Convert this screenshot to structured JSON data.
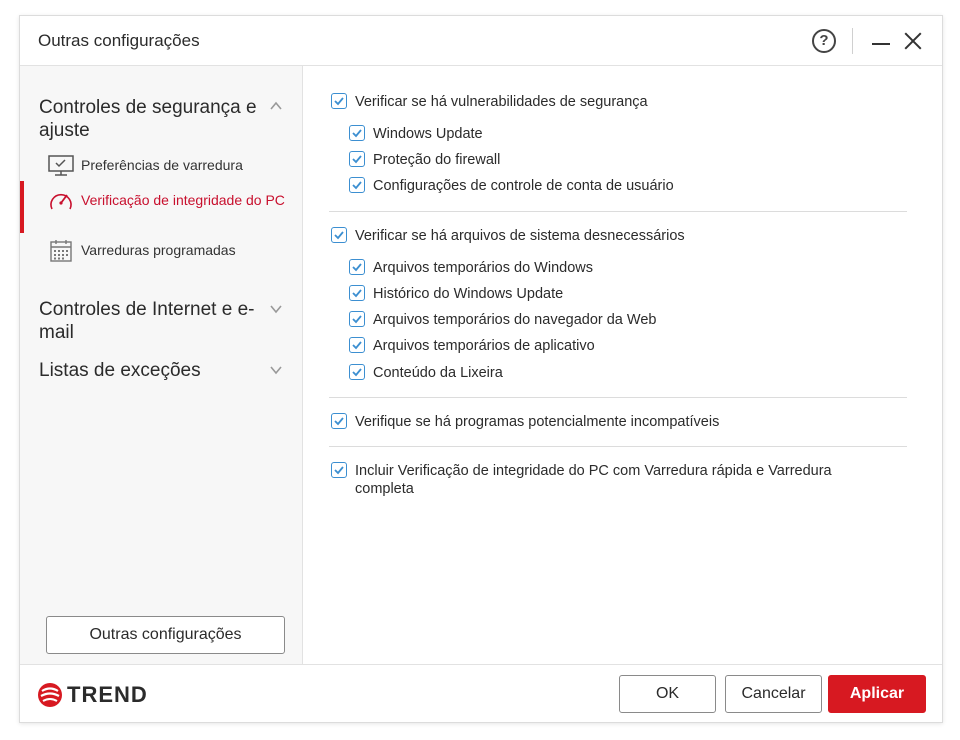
{
  "window": {
    "title": "Outras configurações"
  },
  "titlebar": {
    "help_glyph": "?",
    "help_icon": "help-circle-icon",
    "minimize_icon": "minimize-icon",
    "close_icon": "close-icon"
  },
  "sidebar": {
    "sections": [
      {
        "label": "Controles de segurança e ajuste",
        "expanded": true
      },
      {
        "label": "Controles de Internet e e-mail",
        "expanded": false
      },
      {
        "label": "Listas de exceções",
        "expanded": false
      }
    ],
    "items": [
      {
        "label": "Preferências de varredura",
        "icon": "monitor-check-icon",
        "active": false
      },
      {
        "label": "Verificação de integridade do PC",
        "icon": "gauge-icon",
        "active": true
      },
      {
        "label": "Varreduras programadas",
        "icon": "calendar-icon",
        "active": false
      }
    ],
    "bottom_button": "Outras configurações"
  },
  "content": {
    "groups": [
      {
        "label": "Verificar se há vulnerabilidades de segurança",
        "checked": true,
        "children": [
          {
            "label": "Windows Update",
            "checked": true
          },
          {
            "label": "Proteção do firewall",
            "checked": true
          },
          {
            "label": "Configurações de controle de conta de usuário",
            "checked": true
          }
        ]
      },
      {
        "label": "Verificar se há arquivos de sistema desnecessários",
        "checked": true,
        "children": [
          {
            "label": "Arquivos temporários do Windows",
            "checked": true
          },
          {
            "label": "Histórico do Windows Update",
            "checked": true
          },
          {
            "label": "Arquivos temporários do navegador da Web",
            "checked": true
          },
          {
            "label": "Arquivos temporários de aplicativo",
            "checked": true
          },
          {
            "label": "Conteúdo da Lixeira",
            "checked": true
          }
        ]
      },
      {
        "label": "Verifique se há programas potencialmente incompatíveis",
        "checked": true,
        "children": []
      },
      {
        "label": "Incluir Verificação de integridade do PC com Varredura rápida e Varredura completa",
        "checked": true,
        "children": []
      }
    ]
  },
  "footer": {
    "brand": "TREND",
    "ok_label": "OK",
    "cancel_label": "Cancelar",
    "apply_label": "Aplicar"
  },
  "colors": {
    "accent_red": "#d71921",
    "checkbox_blue": "#3c8fd1"
  }
}
